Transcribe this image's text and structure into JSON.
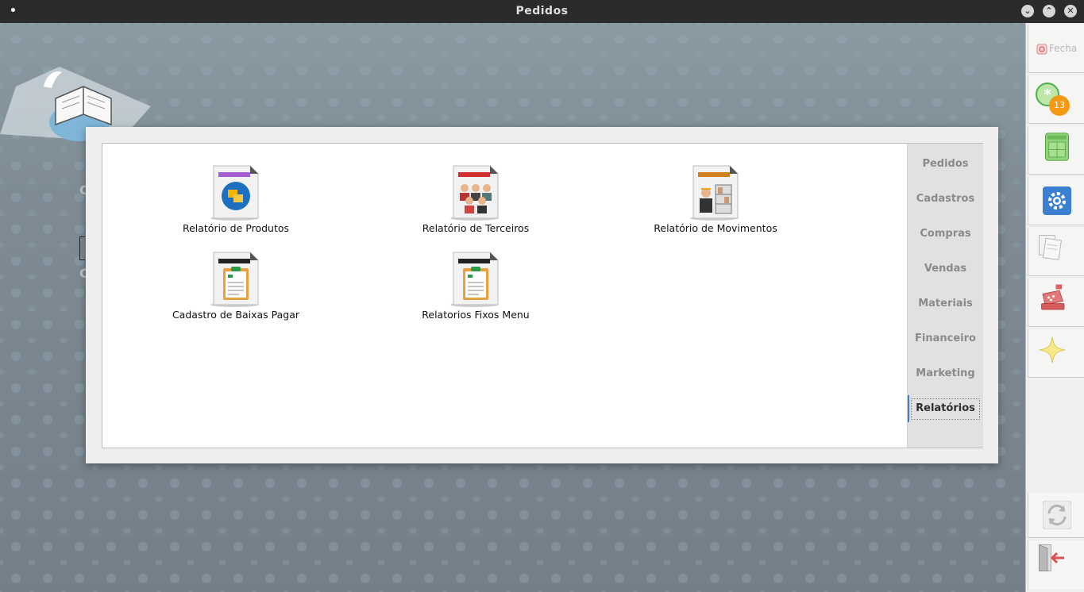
{
  "window": {
    "title": "Pedidos"
  },
  "titlebar_buttons": [
    "minimize-icon",
    "maximize-icon",
    "close-icon"
  ],
  "rightbar": {
    "close_label": "Fecha",
    "notification_count": "13"
  },
  "tiles": [
    {
      "label": "Relatório de Produtos",
      "icon": "products-report-icon"
    },
    {
      "label": "Relatório de Terceiros",
      "icon": "people-report-icon"
    },
    {
      "label": "Relatório de Movimentos",
      "icon": "movements-report-icon"
    },
    {
      "label": "Cadastro de Baixas Pagar",
      "icon": "clipboard-document-icon"
    },
    {
      "label": "Relatorios Fixos Menu",
      "icon": "clipboard-document-icon"
    }
  ],
  "tabs": [
    {
      "label": "Pedidos"
    },
    {
      "label": "Cadastros"
    },
    {
      "label": "Compras"
    },
    {
      "label": "Vendas"
    },
    {
      "label": "Materiais"
    },
    {
      "label": "Financeiro"
    },
    {
      "label": "Marketing"
    },
    {
      "label": "Relatórios",
      "active": true
    }
  ]
}
